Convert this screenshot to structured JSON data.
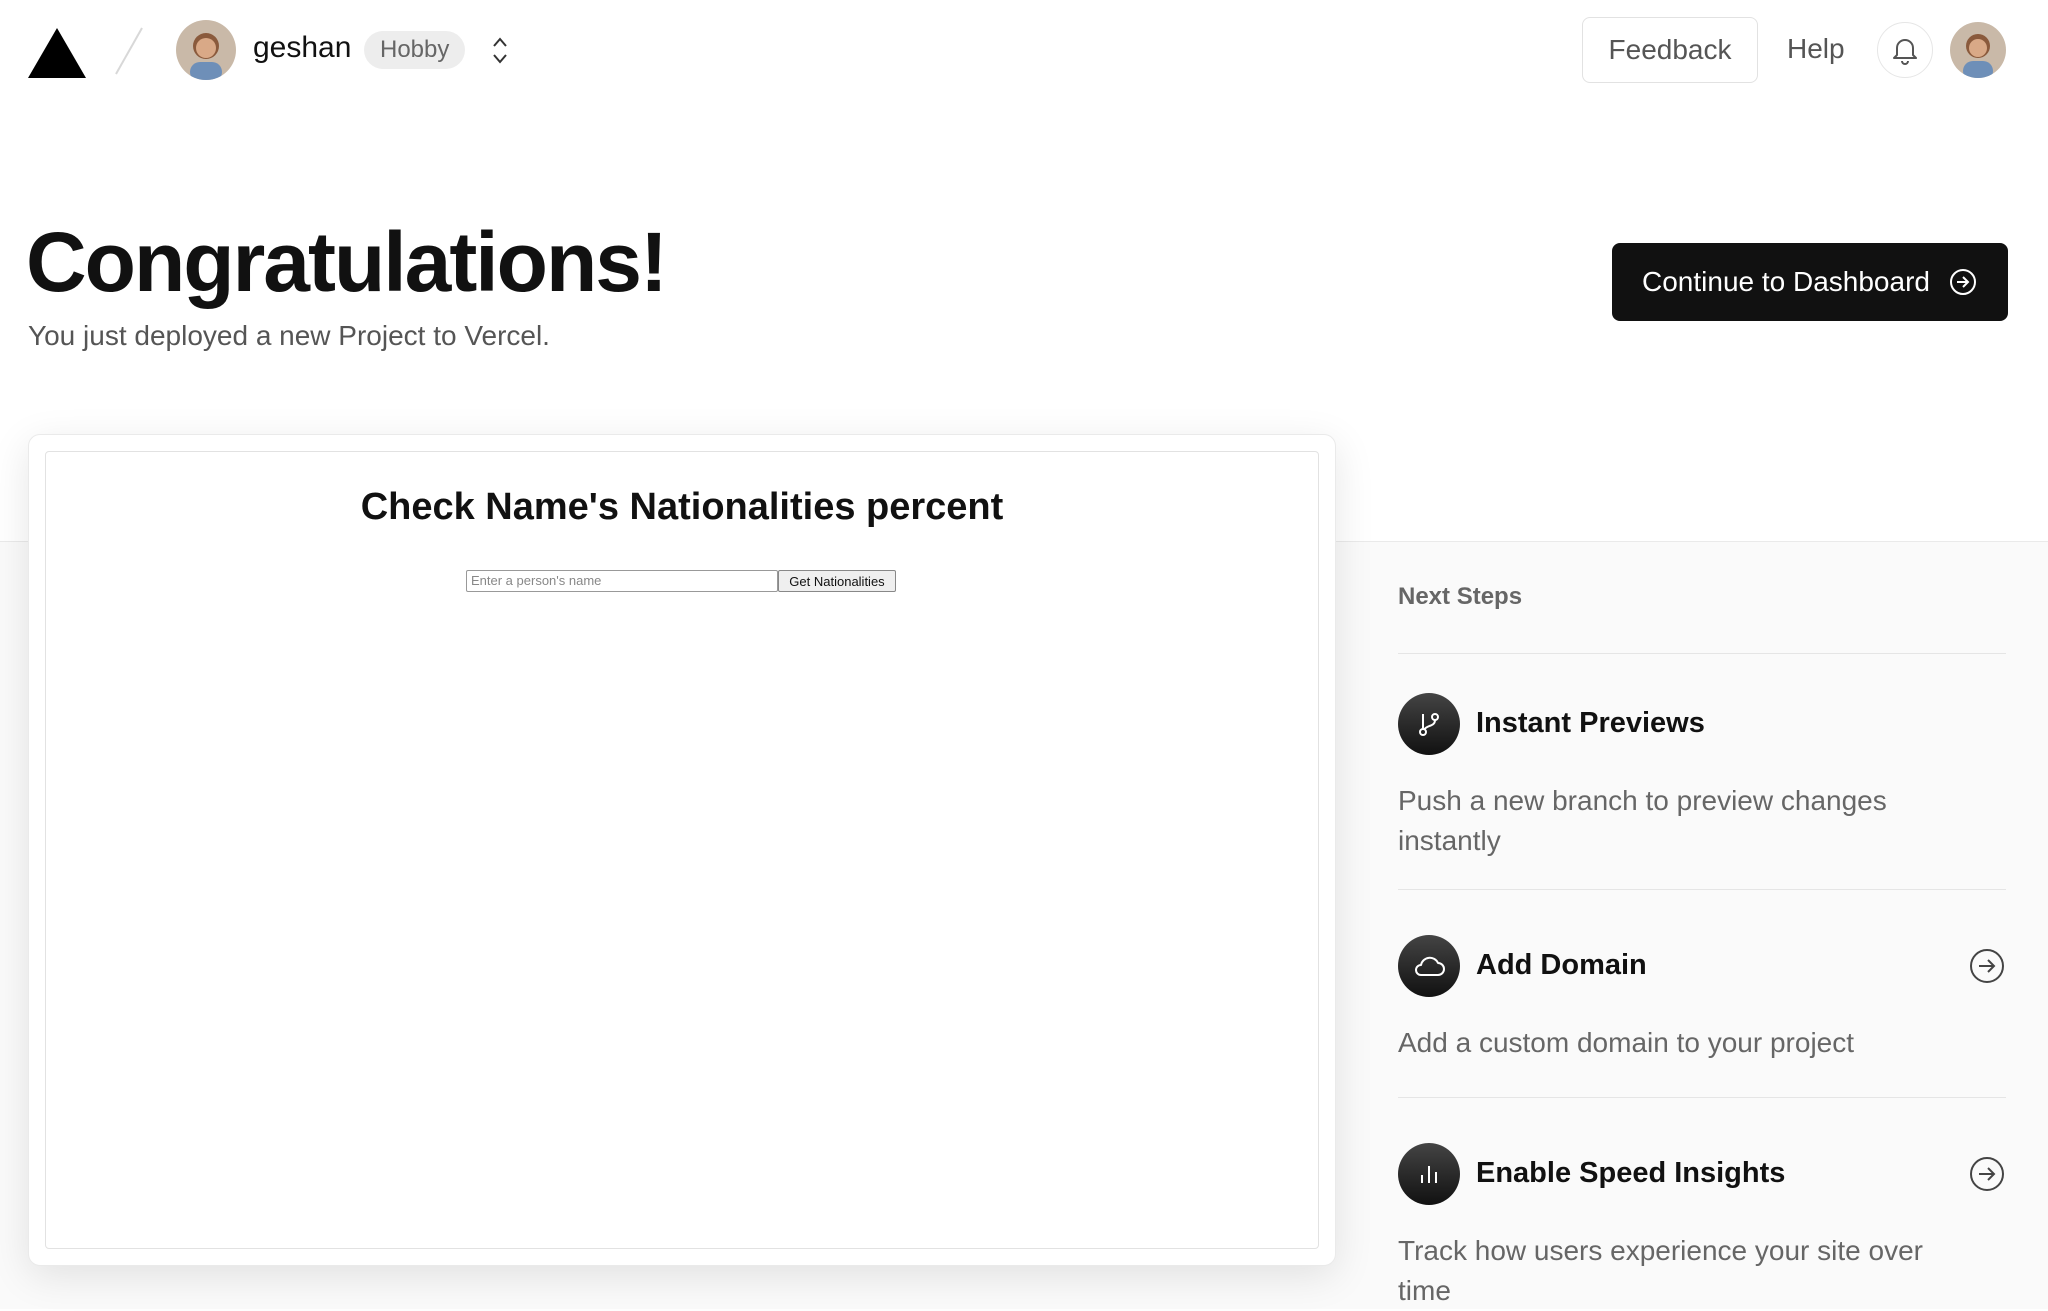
{
  "topbar": {
    "username": "geshan",
    "plan_badge": "Hobby",
    "feedback_label": "Feedback",
    "help_label": "Help"
  },
  "header": {
    "title": "Congratulations!",
    "subtitle": "You just deployed a new Project to Vercel.",
    "continue_label": "Continue to Dashboard"
  },
  "preview": {
    "heading": "Check Name's Nationalities percent",
    "input_placeholder": "Enter a person's name",
    "button_label": "Get Nationalities"
  },
  "next_steps": {
    "title": "Next Steps",
    "items": [
      {
        "title": "Instant Previews",
        "description": "Push a new branch to preview changes instantly",
        "icon": "git-branch-icon"
      },
      {
        "title": "Add Domain",
        "description": "Add a custom domain to your project",
        "icon": "cloud-icon"
      },
      {
        "title": "Enable Speed Insights",
        "description": "Track how users experience your site over time",
        "icon": "bar-chart-icon"
      }
    ]
  }
}
